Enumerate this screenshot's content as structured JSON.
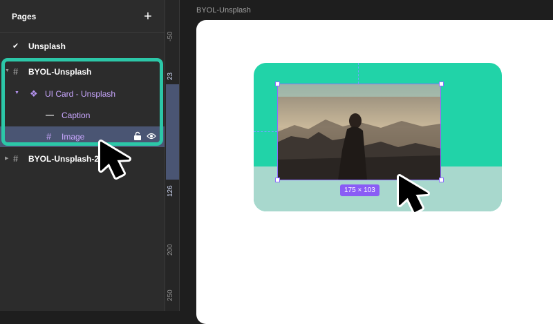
{
  "pages_panel": {
    "title": "Pages",
    "add_icon": "plus-icon",
    "pages": [
      {
        "label": "Unsplash",
        "icon": "check-icon",
        "active": true
      }
    ]
  },
  "layers": [
    {
      "label": "BYOL-Unsplash",
      "icon": "frame-hash-icon",
      "type": "frame"
    },
    {
      "label": "UI Card - Unsplash",
      "icon": "component-instance-icon",
      "type": "instance"
    },
    {
      "label": "Caption",
      "icon": "line-icon",
      "type": "line"
    },
    {
      "label": "Image",
      "icon": "frame-hash-icon",
      "type": "frame",
      "selected": true,
      "row_icons": [
        "lock-icon",
        "eye-icon"
      ]
    },
    {
      "label": "BYOL-Unsplash-2",
      "icon": "frame-hash-icon",
      "type": "frame"
    }
  ],
  "ruler": {
    "ticks": [
      "-50",
      "23",
      "126",
      "200",
      "250"
    ]
  },
  "canvas": {
    "frame_label": "BYOL-Unsplash",
    "selection_size": "175 × 103"
  },
  "colors": {
    "panel_bg": "#2c2c2c",
    "canvas_bg": "#1e1e1e",
    "highlight_border": "#2cc7a8",
    "card_teal": "#21d3a8",
    "caption_area": "#a8d8cd",
    "selection_purple": "#8c6cff",
    "layer_purple_text": "#c9a7ff",
    "selected_row": "#4a5573"
  }
}
